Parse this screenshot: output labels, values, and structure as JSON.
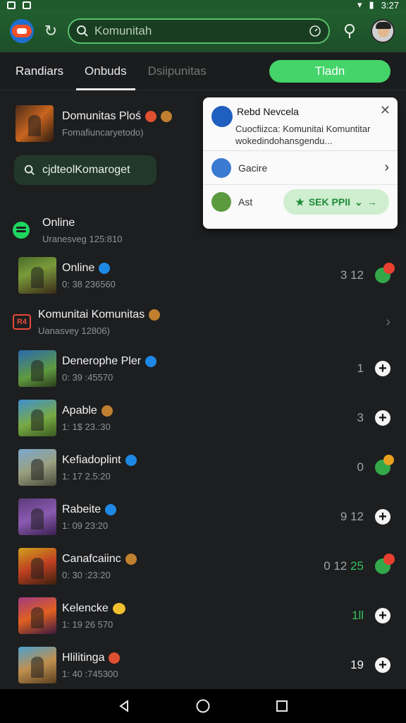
{
  "status": {
    "time": "3:27"
  },
  "header": {
    "search_placeholder": "Komunitah"
  },
  "tabs": [
    {
      "label": "Randiars",
      "state": "normal"
    },
    {
      "label": "Onbuds",
      "state": "active"
    },
    {
      "label": "Dsiipunitas",
      "state": "dim"
    }
  ],
  "trade_button": {
    "label": "Tladn"
  },
  "featured": {
    "title": "Domunitas Ploś",
    "subtitle": "Fomafiuncaryetodo)"
  },
  "chip": {
    "label": "cjdteolKomaroget"
  },
  "rows": [
    {
      "title": "Online",
      "subtitle": "Uranesveg 125:810",
      "count": "",
      "action": "none",
      "icon": "spotify-icon"
    },
    {
      "title": "Online",
      "subtitle": "0: 38 236560",
      "count": "3 12",
      "count_green": "",
      "action": "green-red-badge",
      "icon": "thumb"
    },
    {
      "title": "Komunitai Komunitas",
      "subtitle": "Uanasvey 12806)",
      "count": "",
      "action": "chevron",
      "icon": "r-icon"
    },
    {
      "title": "Denerophe Pler",
      "subtitle": "0: 39 :45570",
      "count": "1",
      "count_green": "",
      "action": "plus"
    },
    {
      "title": "Apable",
      "subtitle": "1: 1$ 23.:30",
      "count": "3",
      "count_green": "",
      "action": "plus"
    },
    {
      "title": "Kefiadoplint",
      "subtitle": "1: 17 2.5:20",
      "count": "0",
      "count_green": "",
      "action": "green-orange-badge"
    },
    {
      "title": "Rabeite",
      "subtitle": "1: 09 23:20",
      "count": "9 12",
      "count_green": "",
      "action": "plus"
    },
    {
      "title": "Canafcaiinc",
      "subtitle": "0: 30 :23:20",
      "count": "0 12",
      "count_green": "25",
      "action": "green-red-badge"
    },
    {
      "title": "Kelencke",
      "subtitle": "1: 19 26 570",
      "count": "",
      "count_green": "1ll",
      "action": "plus"
    },
    {
      "title": "Hlilitinga",
      "subtitle": "1: 40 :745300",
      "count": "19",
      "count_green": "",
      "action": "plus"
    }
  ],
  "row_labels": {
    "badge_r": "R4"
  },
  "popup": {
    "title": "Rebd Nevcela",
    "body": "Cuocfiizca: Komunitai Komuntitar wokedindohansgendu...",
    "row1_label": "Gacire",
    "row2_label": "Ast",
    "pill_label": "SEK PPII"
  },
  "colors": {
    "accent": "#45d46a",
    "header": "#215f2f",
    "background": "#1d1e20"
  }
}
